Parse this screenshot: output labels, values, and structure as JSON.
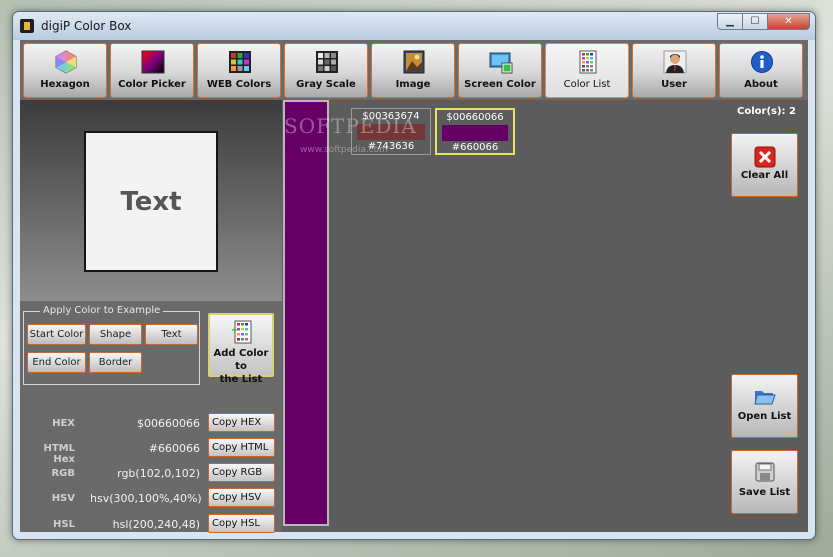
{
  "window": {
    "title": "digiP Color Box",
    "min_glyph": "▁",
    "max_glyph": "☐",
    "close_glyph": "✕"
  },
  "toolbar": [
    {
      "label": "Hexagon",
      "icon": "hexagon-icon"
    },
    {
      "label": "Color Picker",
      "icon": "color-picker-icon"
    },
    {
      "label": "WEB Colors",
      "icon": "web-colors-icon"
    },
    {
      "label": "Gray Scale",
      "icon": "gray-scale-icon"
    },
    {
      "label": "Image",
      "icon": "image-icon"
    },
    {
      "label": "Screen Color",
      "icon": "screen-color-icon"
    },
    {
      "label": "Color List",
      "icon": "color-list-icon",
      "active": true
    },
    {
      "label": "User",
      "icon": "user-icon"
    },
    {
      "label": "About",
      "icon": "info-icon"
    }
  ],
  "preview": {
    "text": "Text"
  },
  "apply": {
    "title": "Apply Color to Example",
    "start_color": "Start Color",
    "shape": "Shape",
    "text": "Text",
    "end_color": "End Color",
    "border": "Border"
  },
  "add_button": {
    "line1": "Add Color to",
    "line2": "the List"
  },
  "values": [
    {
      "label": "HEX",
      "value": "$00660066",
      "copy": "Copy HEX"
    },
    {
      "label": "HTML Hex",
      "value": "#660066",
      "copy": "Copy HTML"
    },
    {
      "label": "RGB",
      "value": "rgb(102,0,102)",
      "copy": "Copy RGB"
    },
    {
      "label": "HSV",
      "value": "hsv(300,100%,40%)",
      "copy": "Copy HSV"
    },
    {
      "label": "HSL",
      "value": "hsl(200,240,48)",
      "copy": "Copy HSL"
    }
  ],
  "current_color": "#660066",
  "color_list": {
    "count_label": "Color(s): 2",
    "items": [
      {
        "hex": "$00363674",
        "html": "#743636",
        "color": "#743636"
      },
      {
        "hex": "$00660066",
        "html": "#660066",
        "color": "#660066",
        "selected": true
      }
    ]
  },
  "right_buttons": {
    "clear_all": "Clear All",
    "open_list": "Open List",
    "save_list": "Save List"
  },
  "watermark": {
    "brand": "SOFTPEDIA",
    "url": "www.softpedia.com"
  },
  "colors": {
    "accent_border": "#d06f38",
    "selected_border": "#e6e35c",
    "panel": "#5f5f5f"
  }
}
